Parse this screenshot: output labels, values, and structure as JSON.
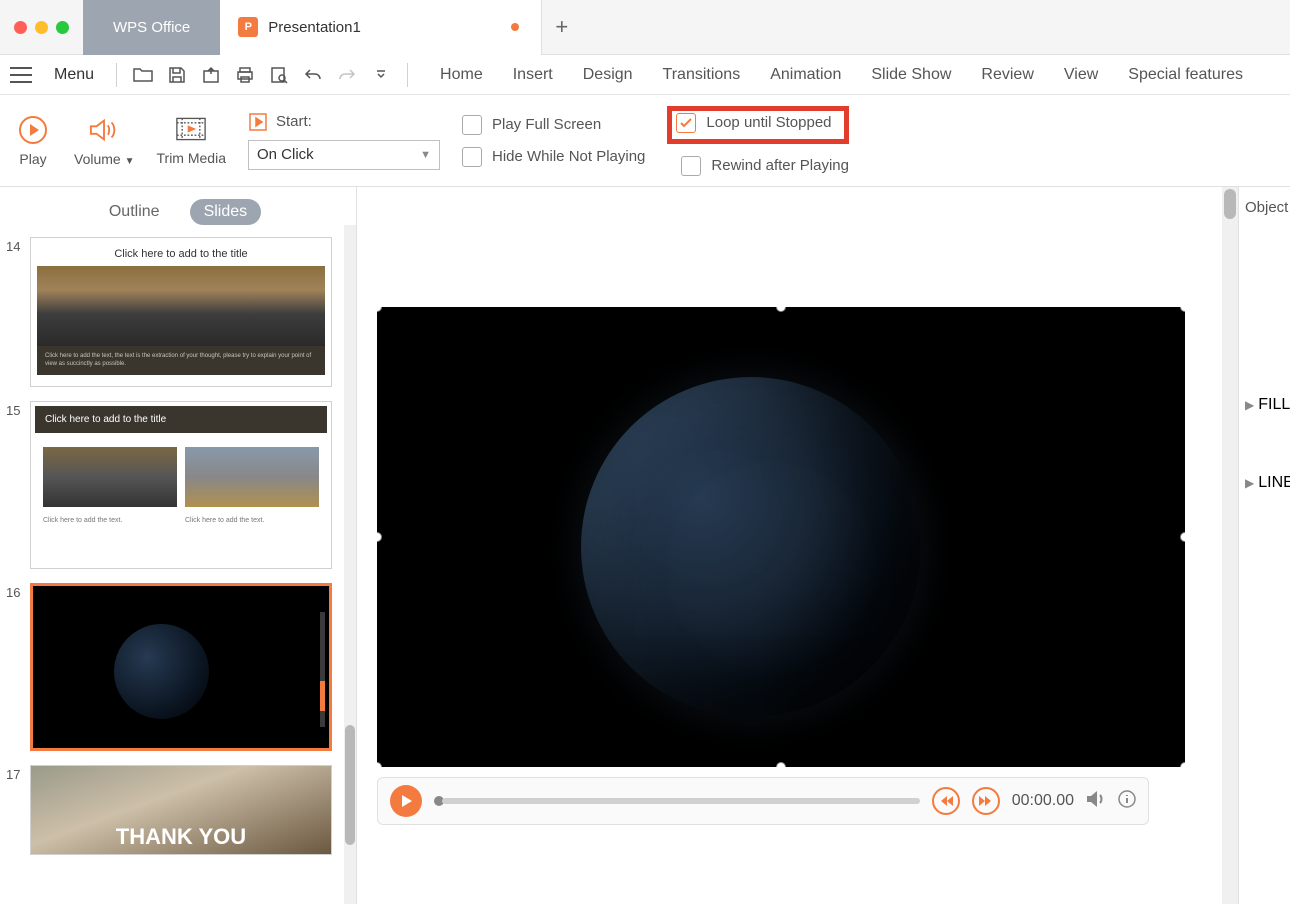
{
  "titlebar": {
    "app_name": "WPS Office",
    "doc_title": "Presentation1"
  },
  "menu": {
    "menu_label": "Menu",
    "ribbon_tabs": [
      "Home",
      "Insert",
      "Design",
      "Transitions",
      "Animation",
      "Slide Show",
      "Review",
      "View",
      "Special features"
    ]
  },
  "ribbon": {
    "play": "Play",
    "volume": "Volume",
    "trim": "Trim Media",
    "start_label": "Start:",
    "start_value": "On Click",
    "opts": {
      "full_screen": "Play Full Screen",
      "hide": "Hide While Not Playing",
      "loop": "Loop until Stopped",
      "rewind": "Rewind after Playing"
    }
  },
  "sidebar": {
    "tab_outline": "Outline",
    "tab_slides": "Slides",
    "slides": [
      {
        "num": "14",
        "title": "Click here to add to the title",
        "caption": "Click here to add the text, the text is the extraction of your thought, please try to explain your point of view as succinctly as possible."
      },
      {
        "num": "15",
        "title": "Click here to add to the title",
        "cap_a": "Click here to add the text.",
        "cap_b": "Click here to add the text."
      },
      {
        "num": "16"
      },
      {
        "num": "17",
        "text": "THANK YOU"
      }
    ]
  },
  "player": {
    "time": "00:00.00"
  },
  "right_panel": {
    "object": "Object",
    "fill": "FILL",
    "line": "LINE"
  }
}
